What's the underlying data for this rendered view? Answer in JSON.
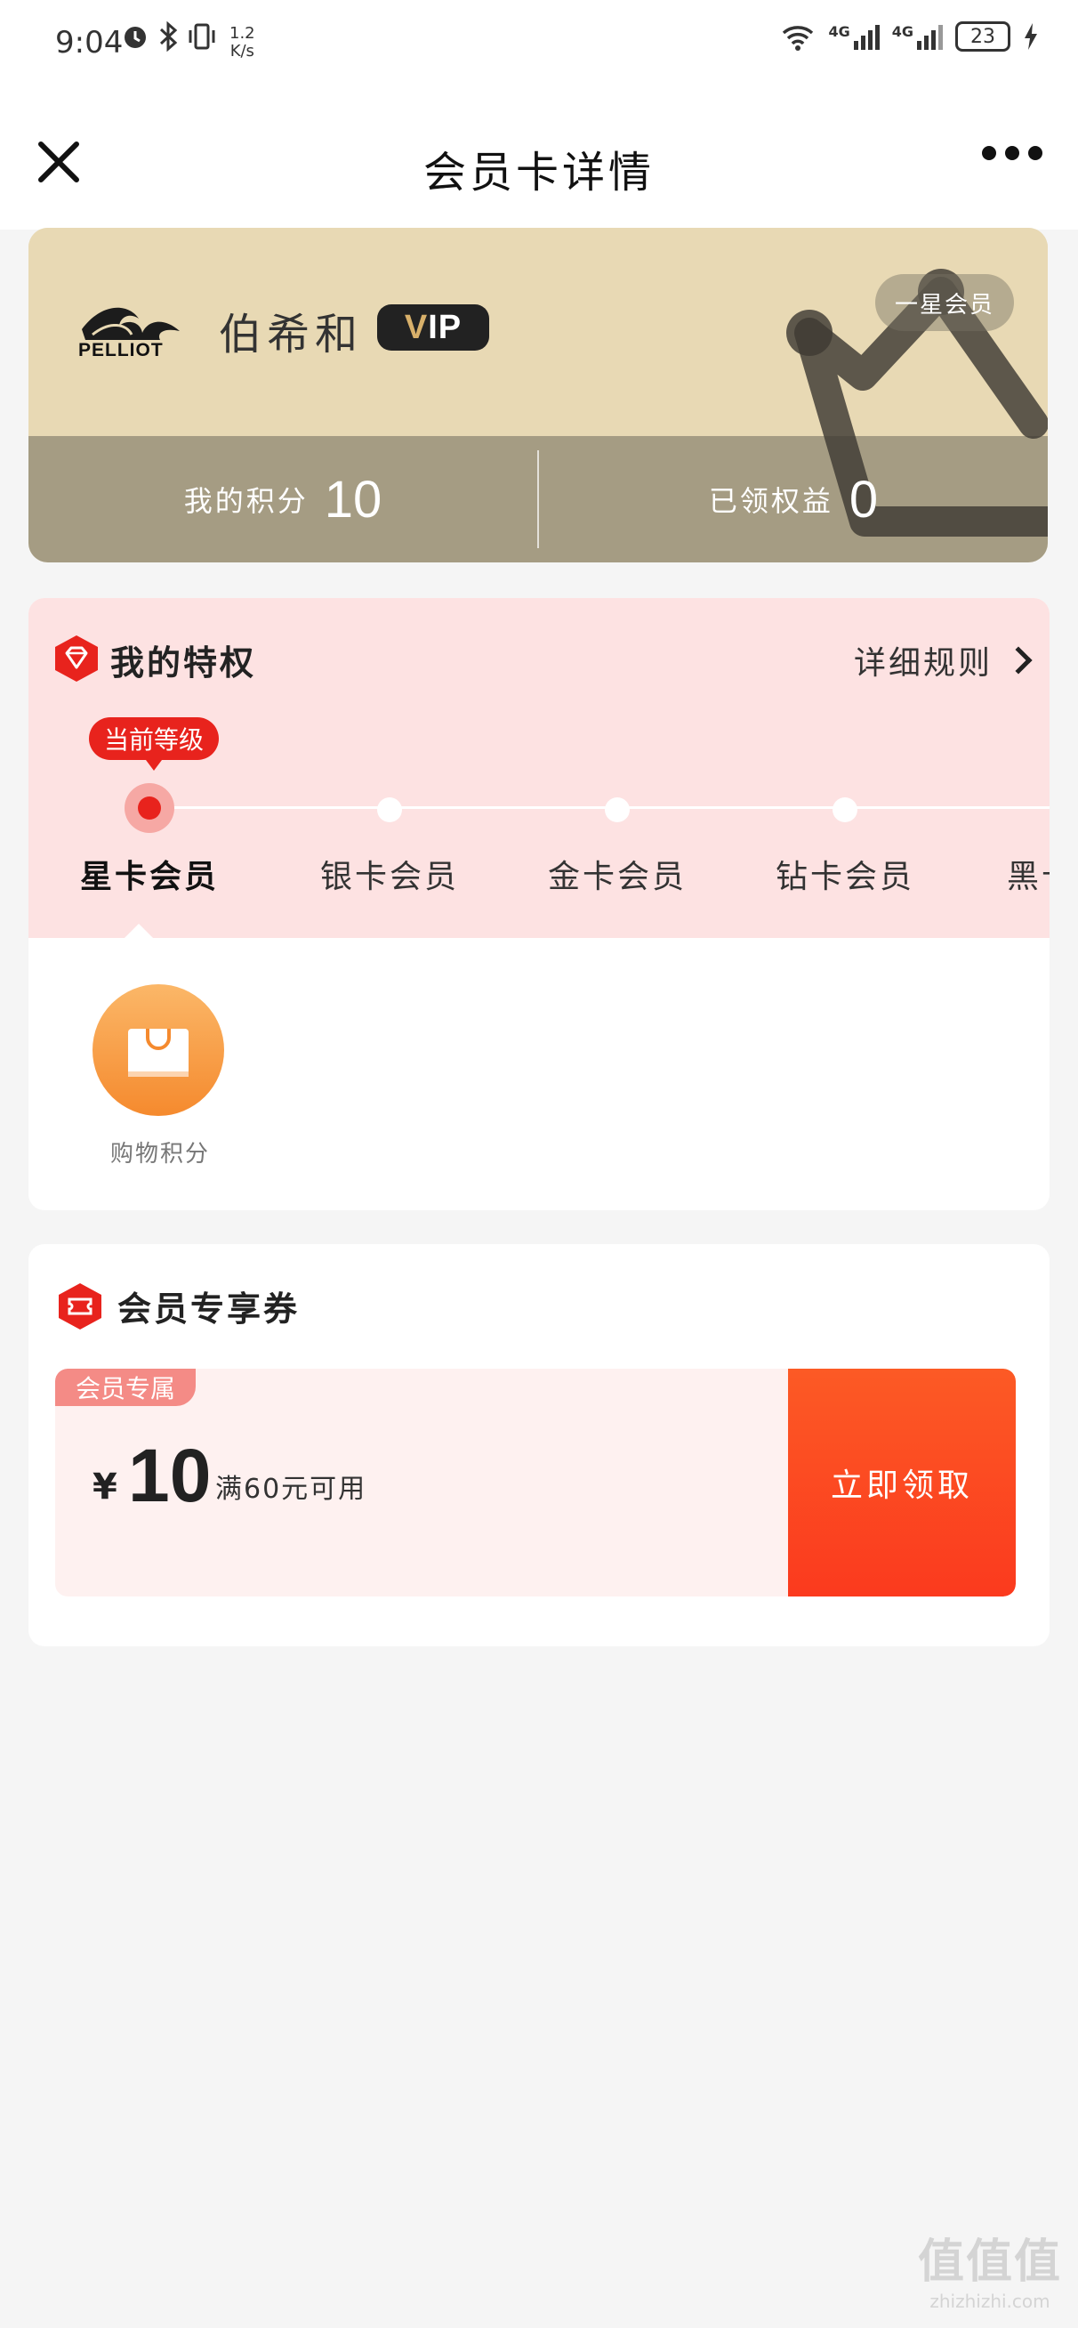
{
  "status_bar": {
    "time": "9:04",
    "speed_value": "1.2",
    "speed_unit": "K/s",
    "battery": "23",
    "net1": "4G",
    "net2": "4G"
  },
  "nav": {
    "title": "会员卡详情"
  },
  "card": {
    "logo_text": "PELLIOT",
    "brand": "伯希和",
    "vip": "VIP",
    "level": "一星会员",
    "points_label": "我的积分",
    "points_value": "10",
    "benefits_label": "已领权益",
    "benefits_value": "0",
    "colors": {
      "top": "#e8d9b4",
      "bottom": "#a59c83"
    }
  },
  "privileges": {
    "title": "我的特权",
    "rules_link": "详细规则",
    "current_tag": "当前等级",
    "tiers": [
      "星卡会员",
      "银卡会员",
      "金卡会员",
      "钻卡会员",
      "黑卡"
    ],
    "benefits": [
      {
        "label": "购物积分",
        "icon": "shopping-bag-icon"
      }
    ],
    "colors": {
      "accent": "#e8231d",
      "header_bg": "#fde2e2"
    }
  },
  "coupons": {
    "title": "会员专享券",
    "items": [
      {
        "tag": "会员专属",
        "currency": "¥",
        "amount": "10",
        "condition": "满60元可用",
        "action": "立即领取"
      }
    ],
    "colors": {
      "button": "#fb3a1e"
    }
  },
  "watermark": {
    "text": "值值值",
    "sub": "zhizhizhi.com"
  }
}
